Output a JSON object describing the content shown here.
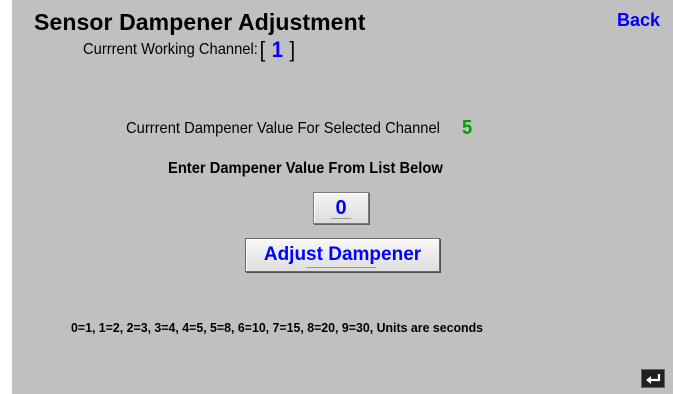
{
  "header": {
    "title": "Sensor Dampener Adjustment",
    "back_label": "Back"
  },
  "channel": {
    "label": "Currrent Working Channel:",
    "open_bracket": "[",
    "value": "1",
    "close_bracket": "]"
  },
  "current_dampener": {
    "label": "Currrent Dampener Value For Selected Channel",
    "value": "5"
  },
  "entry": {
    "label": "Enter Dampener Value From List Below",
    "input_value": "0",
    "adjust_button_label": "Adjust Dampener"
  },
  "units_note": "0=1, 1=2, 2=3, 3=4, 4=5, 5=8, 6=10, 7=15, 8=20, 9=30, Units are seconds",
  "colors": {
    "background": "#c0c0c0",
    "accent_blue": "#0000ff",
    "value_green": "#00a000"
  },
  "icons": {
    "return": "return-arrow-icon"
  }
}
